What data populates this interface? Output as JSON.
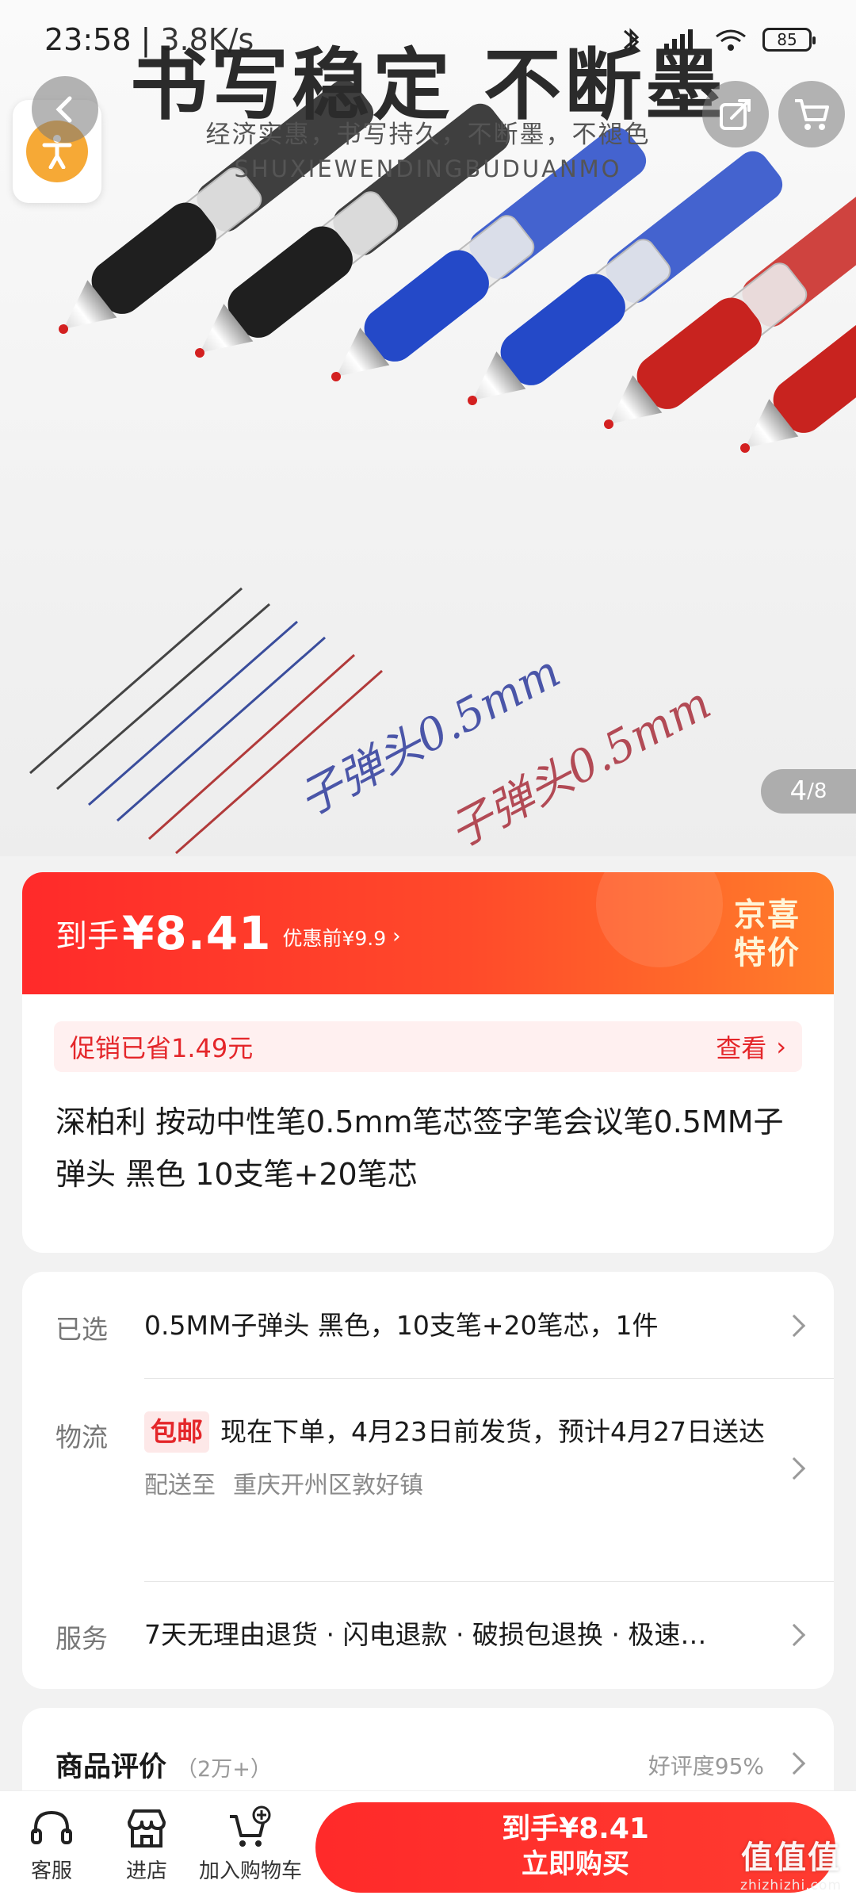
{
  "status_bar": {
    "time": "23:58",
    "separator": "|",
    "network": "3.8K/s",
    "battery": "85"
  },
  "hero": {
    "title": "书写稳定 不断墨",
    "subtitle": "经济实惠，书写持久，不断墨，不褪色",
    "pinyin": "SHUXIEWENDINGBUDUANMO",
    "handwriting_1": "子弹头0.5mm",
    "handwriting_2": "子弹头0.5mm",
    "pen_colors": [
      "#1f1f1f",
      "#1f1f1f",
      "#2449c8",
      "#2449c8",
      "#c8231f",
      "#c8231f"
    ],
    "image_index": "4",
    "image_total": "/8"
  },
  "price": {
    "label": "到手",
    "value": "¥8.41",
    "before": "优惠前¥9.9",
    "badge_line1": "京喜",
    "badge_line2": "特价",
    "promo_text": "促销已省1.49元",
    "promo_view": "查看",
    "product_title": "深柏利 按动中性笔0.5mm笔芯签字笔会议笔0.5MM子弹头 黑色 10支笔+20笔芯"
  },
  "options": {
    "selected_key": "已选",
    "selected_value": "0.5MM子弹头 黑色，10支笔+20笔芯，1件",
    "shipping_key": "物流",
    "free_shipping_tag": "包邮",
    "shipping_value": "现在下单，4月23日前发货，预计4月27日送达",
    "deliver_to_label": "配送至",
    "deliver_to_address": "重庆开州区敦好镇",
    "service_key": "服务",
    "service_value": "7天无理由退货 · 闪电退款 · 破损包退换 · 极速…"
  },
  "reviews": {
    "title": "商品评价",
    "count": "（2万+）",
    "rate": "好评度95%"
  },
  "bottom_bar": {
    "service_label": "客服",
    "shop_label": "进店",
    "cart_label": "加入购物车",
    "buy_price": "到手¥8.41",
    "buy_label": "立即购买"
  },
  "watermark": {
    "logo": "值值值",
    "url": "zhizhizhi.com"
  },
  "colors": {
    "accent": "#ff2a2a",
    "promo_text": "#e4262a",
    "access": "#f6a936"
  }
}
